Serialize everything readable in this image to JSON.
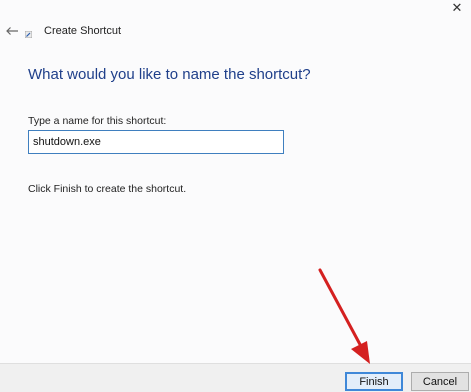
{
  "window": {
    "title": "Create Shortcut",
    "close_glyph": "✕",
    "back_icon": "back-arrow-icon"
  },
  "content": {
    "heading": "What would you like to name the shortcut?",
    "field_label": "Type a name for this shortcut:",
    "name_value": "shutdown.exe",
    "instruction": "Click Finish to create the shortcut."
  },
  "buttons": {
    "finish_label": "Finish",
    "cancel_label": "Cancel"
  },
  "colors": {
    "heading": "#1f3f8a",
    "input_border": "#3f7fbf",
    "finish_border": "#3f88d8",
    "annotation_arrow": "#d42020"
  }
}
